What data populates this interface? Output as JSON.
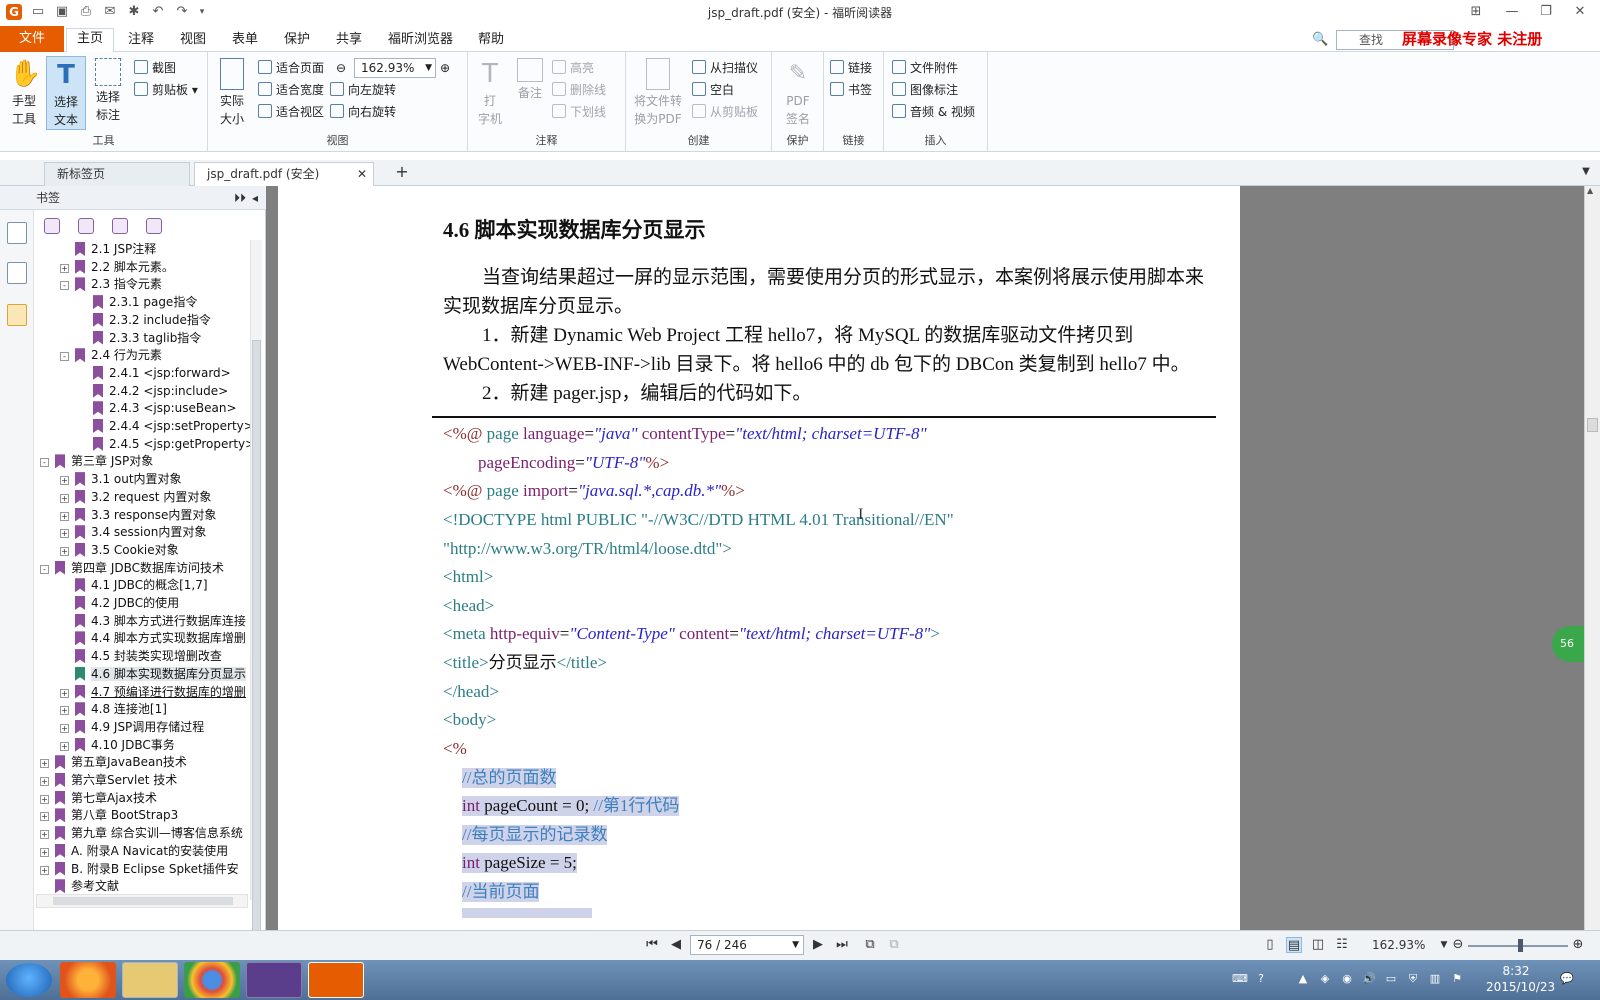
{
  "window": {
    "title": "jsp_draft.pdf (安全) - 福昕阅读器"
  },
  "menu": {
    "file": "文件",
    "tabs": [
      "主页",
      "注释",
      "视图",
      "表单",
      "保护",
      "共享",
      "福昕浏览器",
      "帮助"
    ]
  },
  "search": {
    "placeholder": "查找"
  },
  "watermark": "屏幕录像专家 未注册",
  "ribbon": {
    "tools": {
      "group": "工具",
      "hand_l1": "手型",
      "hand_l2": "工具",
      "select_l1": "选择",
      "select_l2": "文本",
      "annot_l1": "选择",
      "annot_l2": "标注",
      "snapshot": "截图",
      "clipboard": "剪贴板"
    },
    "view": {
      "group": "视图",
      "actual_l1": "实际",
      "actual_l2": "大小",
      "fit_page": "适合页面",
      "fit_width": "适合宽度",
      "fit_visible": "适合视区",
      "zoom": "162.93%",
      "rotate_left": "向左旋转",
      "rotate_right": "向右旋转"
    },
    "comment": {
      "group": "注释",
      "typewriter_l1": "打",
      "typewriter_l2": "字机",
      "note": "备注",
      "highlight": "高亮",
      "strikeout": "删除线",
      "underline": "下划线"
    },
    "create": {
      "group": "创建",
      "convert_l1": "将文件转",
      "convert_l2": "换为PDF",
      "from_scanner": "从扫描仪",
      "blank": "空白",
      "from_clipboard": "从剪贴板"
    },
    "protect": {
      "group": "保护",
      "sign_l1": "PDF",
      "sign_l2": "签名"
    },
    "links": {
      "group": "链接",
      "link": "链接",
      "bookmark": "书签"
    },
    "insert": {
      "group": "插入",
      "attachment": "文件附件",
      "image": "图像标注",
      "media": "音频 & 视频"
    }
  },
  "doc_tabs": [
    "新标签页",
    "jsp_draft.pdf (安全)"
  ],
  "sidebar": {
    "title": "书签",
    "tree": [
      {
        "label": "2.1 JSP注释",
        "level": 2,
        "exp": ""
      },
      {
        "label": "2.2 脚本元素。",
        "level": 2,
        "exp": "+"
      },
      {
        "label": "2.3 指令元素",
        "level": 2,
        "exp": "-"
      },
      {
        "label": "2.3.1 page指令",
        "level": 3,
        "exp": ""
      },
      {
        "label": "2.3.2 include指令",
        "level": 3,
        "exp": ""
      },
      {
        "label": "2.3.3 taglib指令",
        "level": 3,
        "exp": ""
      },
      {
        "label": "2.4 行为元素",
        "level": 2,
        "exp": "-"
      },
      {
        "label": "2.4.1 <jsp:forward>",
        "level": 3,
        "exp": ""
      },
      {
        "label": "2.4.2 <jsp:include>",
        "level": 3,
        "exp": ""
      },
      {
        "label": "2.4.3 <jsp:useBean>",
        "level": 3,
        "exp": ""
      },
      {
        "label": "2.4.4 <jsp:setProperty>",
        "level": 3,
        "exp": ""
      },
      {
        "label": "2.4.5 <jsp:getProperty>",
        "level": 3,
        "exp": ""
      },
      {
        "label": "第三章 JSP对象",
        "level": 1,
        "exp": "-"
      },
      {
        "label": "3.1 out内置对象",
        "level": 2,
        "exp": "+"
      },
      {
        "label": "3.2 request 内置对象",
        "level": 2,
        "exp": "+"
      },
      {
        "label": "3.3 response内置对象",
        "level": 2,
        "exp": "+"
      },
      {
        "label": "3.4 session内置对象",
        "level": 2,
        "exp": "+"
      },
      {
        "label": "3.5 Cookie对象",
        "level": 2,
        "exp": "+"
      },
      {
        "label": "第四章 JDBC数据库访问技术",
        "level": 1,
        "exp": "-"
      },
      {
        "label": "4.1 JDBC的概念[1,7]",
        "level": 2,
        "exp": ""
      },
      {
        "label": "4.2 JDBC的使用",
        "level": 2,
        "exp": ""
      },
      {
        "label": "4.3 脚本方式进行数据库连接",
        "level": 2,
        "exp": ""
      },
      {
        "label": "4.4 脚本方式实现数据库增删",
        "level": 2,
        "exp": ""
      },
      {
        "label": "4.5 封装类实现增删改查",
        "level": 2,
        "exp": ""
      },
      {
        "label": "4.6 脚本实现数据库分页显示",
        "level": 2,
        "exp": "",
        "state": "sel"
      },
      {
        "label": "4.7 预编译进行数据库的增删",
        "level": 2,
        "exp": "+",
        "state": "hover"
      },
      {
        "label": "4.8 连接池[1]",
        "level": 2,
        "exp": "+"
      },
      {
        "label": "4.9 JSP调用存储过程",
        "level": 2,
        "exp": "+"
      },
      {
        "label": "4.10  JDBC事务",
        "level": 2,
        "exp": "+"
      },
      {
        "label": "第五章JavaBean技术",
        "level": 1,
        "exp": "+"
      },
      {
        "label": "第六章Servlet 技术",
        "level": 1,
        "exp": "+"
      },
      {
        "label": "第七章Ajax技术",
        "level": 1,
        "exp": "+"
      },
      {
        "label": "第八章 BootStrap3",
        "level": 1,
        "exp": "+"
      },
      {
        "label": "第九章 综合实训—博客信息系统",
        "level": 1,
        "exp": "+"
      },
      {
        "label": "A. 附录A Navicat的安装使用",
        "level": 1,
        "exp": "+"
      },
      {
        "label": "B. 附录B  Eclipse Spket插件安",
        "level": 1,
        "exp": "+"
      },
      {
        "label": "参考文献",
        "level": 1,
        "exp": ""
      }
    ]
  },
  "page": {
    "heading": "4.6  脚本实现数据库分页显示",
    "p1": "当查询结果超过一屏的显示范围，需要使用分页的形式显示，本案例将展示使用脚本来",
    "p1b": "实现数据库分页显示。",
    "p2": "1．新建 Dynamic Web Project 工程 hello7，将 MySQL 的数据库驱动文件拷贝到",
    "p2b": "WebContent->WEB-INF->lib 目录下。将 hello6 中的 db 包下的 DBCon 类复制到 hello7 中。",
    "p3": "2．新建 pager.jsp，编辑后的代码如下。",
    "code": {
      "l1a": "<%@ ",
      "l1b": "page ",
      "l1c": "language",
      "l1d": "=",
      "l1e": "\"java\"",
      "l1f": " contentType",
      "l1g": "=",
      "l1h": "\"text/html; charset=UTF-8\"",
      "l2a": "pageEncoding",
      "l2b": "=",
      "l2c": "\"UTF-8\"",
      "l2d": "%>",
      "l3a": "<%@ ",
      "l3b": "page ",
      "l3c": "import",
      "l3d": "=",
      "l3e": "\"java.sql.*,cap.db.*\"",
      "l3f": "%>",
      "l4": "<!DOCTYPE html PUBLIC \"-//W3C//DTD HTML 4.01 Transitional//EN\"",
      "l5": "\"http://www.w3.org/TR/html4/loose.dtd\">",
      "l6": "<html>",
      "l7": "<head>",
      "l8a": "<meta ",
      "l8b": "http-equiv",
      "l8c": "=",
      "l8d": "\"Content-Type\"",
      "l8e": " content",
      "l8f": "=",
      "l8g": "\"text/html; charset=UTF-8\"",
      "l8h": ">",
      "l9a": "<title>",
      "l9b": "分页显示",
      "l9c": "</title>",
      "l10": "</head>",
      "l11": "<body>",
      "l12": "<%",
      "l13": "//总的页面数",
      "l14a": "int",
      "l14b": " pageCount = 0; ",
      "l14c": "//第1行代码",
      "l15": "//每页显示的记录数",
      "l16a": "int",
      "l16b": " pageSize = 5;",
      "l17": "//当前页面"
    }
  },
  "status": {
    "page": "76 / 246",
    "zoom": "162.93%"
  },
  "taskbar": {
    "time": "8:32",
    "date": "2015/10/23"
  },
  "colors": {
    "accent": "#e65c00",
    "bookmark": "#8b4f9e",
    "highlight": "#cfd3ea"
  }
}
